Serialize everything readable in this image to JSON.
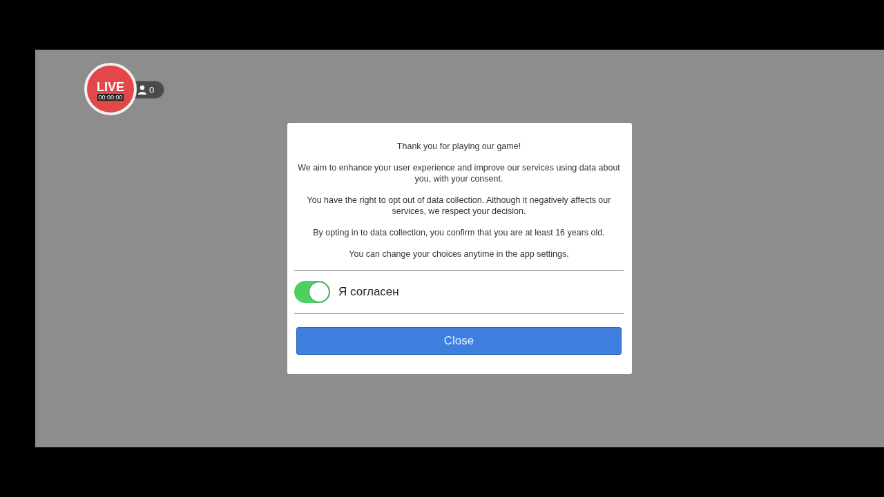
{
  "stream_overlay": {
    "live_label": "LIVE",
    "timer": "00:00:00",
    "viewer_count": "0"
  },
  "dialog": {
    "paragraphs": [
      "Thank you for playing our game!",
      "We aim to enhance your user experience and improve our services using data about you, with your consent.",
      "You have the right to opt out of data collection. Although it negatively affects our services, we respect your decision.",
      "By opting in to data collection, you confirm that you are at least 16 years old.",
      "You can change your choices anytime in the app settings."
    ],
    "consent_toggle": {
      "label": "Я согласен",
      "on": true
    },
    "button": "Close"
  }
}
